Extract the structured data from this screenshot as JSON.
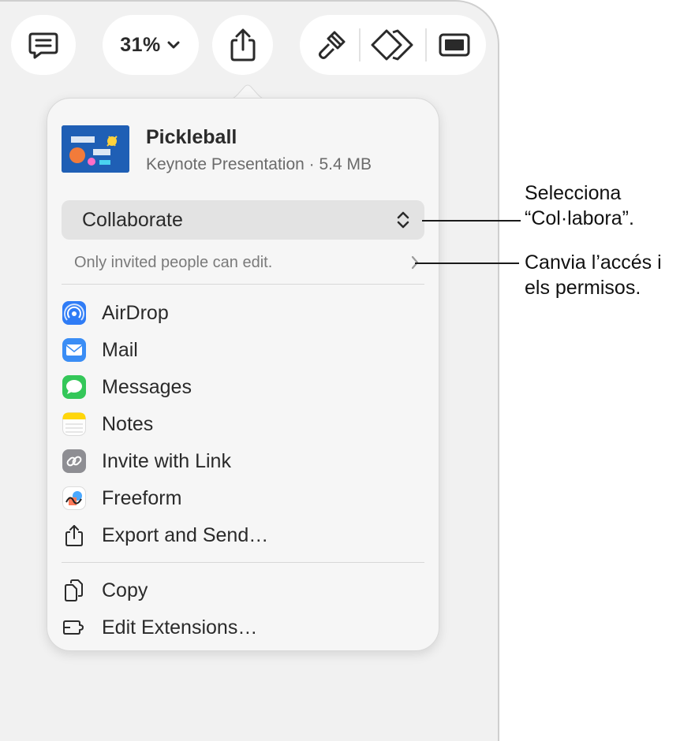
{
  "toolbar": {
    "comment_icon": "comment-bubble-icon",
    "zoom_level": "31%",
    "zoom_chevron": "chevron-down-icon",
    "share_icon": "share-icon",
    "format_icon": "paintbrush-icon",
    "animate_icon": "animate-diamond-icon",
    "document_icon": "document-panel-icon"
  },
  "share_popover": {
    "document": {
      "name": "Pickleball",
      "subtitle": "Keynote Presentation · 5.4 MB"
    },
    "mode_select": {
      "selected": "Collaborate"
    },
    "access_summary": "Only invited people can edit.",
    "items": [
      {
        "label": "AirDrop",
        "icon": "airdrop-icon"
      },
      {
        "label": "Mail",
        "icon": "mail-icon"
      },
      {
        "label": "Messages",
        "icon": "messages-icon"
      },
      {
        "label": "Notes",
        "icon": "notes-icon"
      },
      {
        "label": "Invite with Link",
        "icon": "link-icon"
      },
      {
        "label": "Freeform",
        "icon": "freeform-icon"
      },
      {
        "label": "Export and Send…",
        "icon": "export-icon"
      }
    ],
    "bottom_items": [
      {
        "label": "Copy",
        "icon": "copy-icon"
      },
      {
        "label": "Edit Extensions…",
        "icon": "extensions-icon"
      }
    ]
  },
  "callouts": {
    "collaborate": [
      "Selecciona",
      "“Col·labora”."
    ],
    "access": [
      "Canvia l’accés i",
      "els permisos."
    ]
  },
  "colors": {
    "airdrop": "#2f7cf6",
    "mail": "#3a8df5",
    "messages": "#34c759",
    "notes": "#ffd60a",
    "link": "#8e8e93"
  }
}
